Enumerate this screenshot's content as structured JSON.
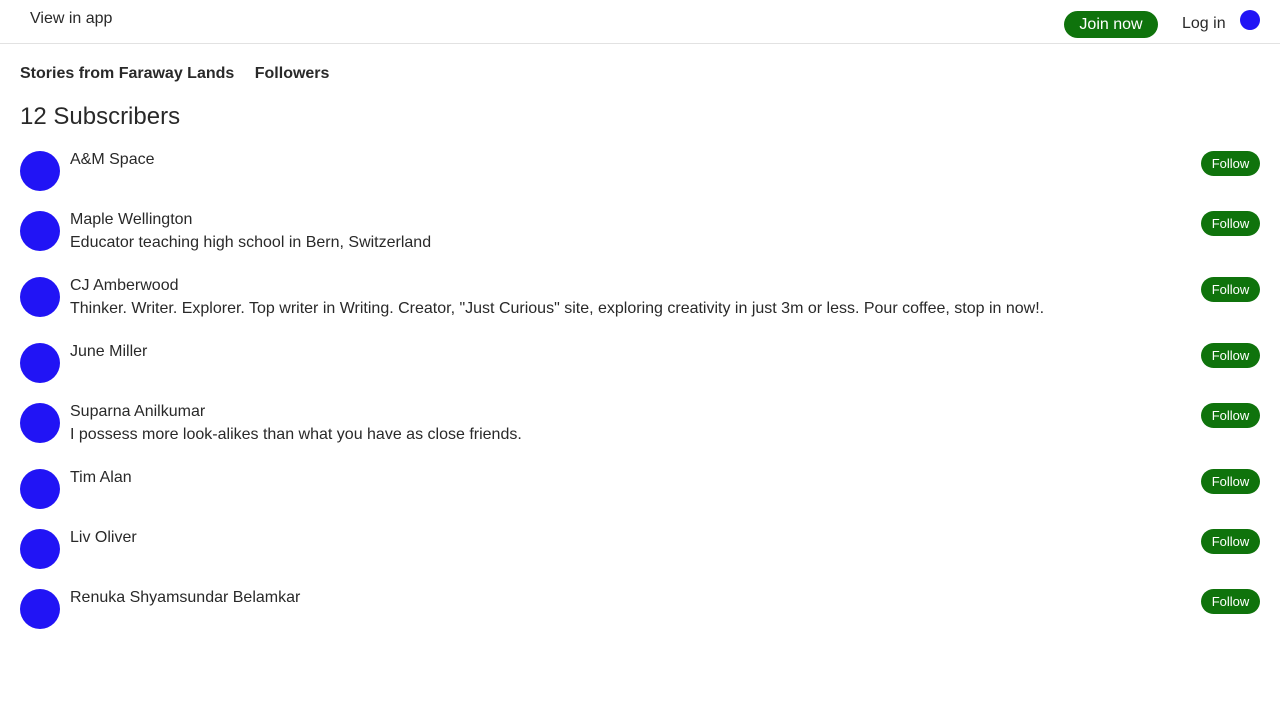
{
  "colors": {
    "accent": "#1a8917",
    "brand_green": "#0f730c",
    "avatar_blue": "#2114f5"
  },
  "header": {
    "view_in_app": "View in app",
    "join_label": "Join now",
    "login_label": "Log in"
  },
  "publication": {
    "name": "Stories from Faraway Lands",
    "tab": "Followers"
  },
  "followers": {
    "count_label": "12 Subscribers",
    "items": [
      {
        "name": "A&M Space",
        "bio": "",
        "follow": "Follow"
      },
      {
        "name": "Maple Wellington",
        "bio": "Educator teaching high school in Bern, Switzerland",
        "follow": "Follow"
      },
      {
        "name": "CJ Amberwood",
        "bio": "Thinker. Writer. Explorer. Top writer in Writing. Creator, \"Just Curious\" site, exploring creativity in just 3m or less. Pour coffee, stop in now!.",
        "follow": "Follow"
      },
      {
        "name": "June Miller",
        "bio": "",
        "follow": "Follow"
      },
      {
        "name": "Suparna Anilkumar",
        "bio": "I possess more look-alikes than what you have as close friends.",
        "follow": "Follow"
      },
      {
        "name": "Tim Alan",
        "bio": "",
        "follow": "Follow"
      },
      {
        "name": "Liv Oliver",
        "bio": "",
        "follow": "Follow"
      },
      {
        "name": "Renuka Shyamsundar Belamkar",
        "bio": "",
        "follow": "Follow"
      }
    ]
  }
}
